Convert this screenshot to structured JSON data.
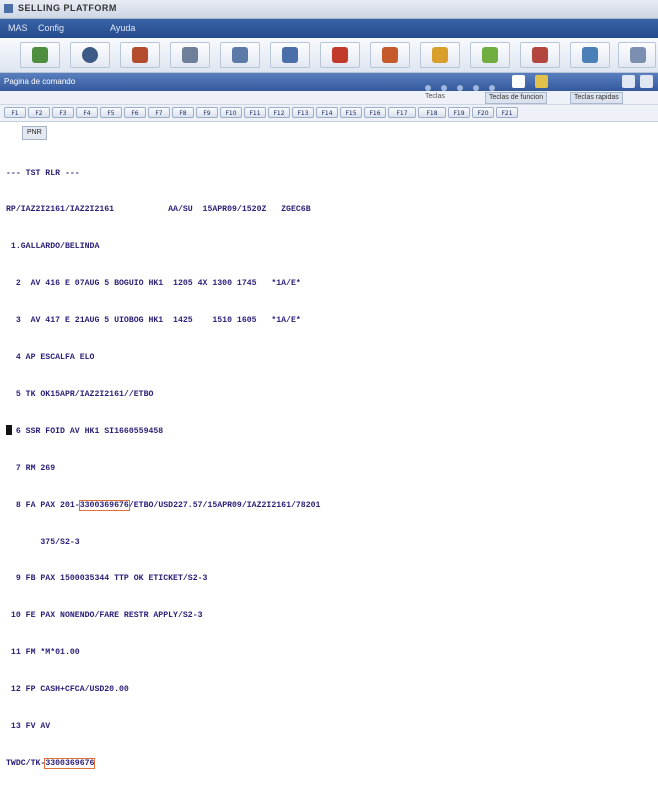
{
  "window": {
    "title": "SELLING PLATFORM"
  },
  "menu": {
    "items": [
      "MAS",
      "Config",
      "Ayuda"
    ]
  },
  "toolbar": {
    "buttons": [
      {
        "icon": "green-plus-icon",
        "color": "#4d8f3f"
      },
      {
        "icon": "globe-icon",
        "color": "#3d5a87"
      },
      {
        "icon": "phone-icon",
        "color": "#b44d2e"
      },
      {
        "icon": "calendar-icon",
        "color": "#6d7f99"
      },
      {
        "icon": "hotel-icon",
        "color": "#5c7aa8"
      },
      {
        "icon": "car-icon",
        "color": "#4a6fa8"
      },
      {
        "icon": "flag-red-icon",
        "color": "#c23a2a"
      },
      {
        "icon": "person-icon",
        "color": "#c75a2a"
      },
      {
        "icon": "question-icon",
        "color": "#d8a02a"
      },
      {
        "icon": "leaf-icon",
        "color": "#6fae3f"
      },
      {
        "icon": "book-icon",
        "color": "#b3473f"
      },
      {
        "icon": "pencil-icon",
        "color": "#4a7fb8"
      }
    ]
  },
  "statusbar": {
    "title": "Pagina de comando",
    "icons": [
      {
        "icon": "arrow-icon",
        "color": "#ffffff"
      },
      {
        "icon": "star-icon",
        "color": "#e2c14a"
      },
      {
        "icon": "search-icon",
        "color": "#e0e6f2"
      },
      {
        "icon": "print-icon",
        "color": "#e0e6f2"
      }
    ]
  },
  "subbar": {
    "label": "Teclas",
    "button1": "Teclas de funcion",
    "button2": "Teclas rapidas"
  },
  "function_keys": [
    "F1",
    "F2",
    "F3",
    "F4",
    "F5",
    "F6",
    "F7",
    "F8",
    "F9",
    "F10",
    "F11",
    "F12",
    "F13",
    "F14",
    "F15",
    "F16",
    "F17",
    "F18",
    "F19",
    "F20",
    "F21"
  ],
  "tab": {
    "label": "PNR"
  },
  "terminal": {
    "lines": [
      "--- TST RLR ---",
      "RP/IAZ2I2161/IAZ2I2161           AA/SU  15APR09/1520Z   ZGEC6B",
      " 1.GALLARDO/BELINDA",
      "  2  AV 416 E 07AUG 5 BOGUIO HK1  1205 4X 1300 1745   *1A/E*",
      "  3  AV 417 E 21AUG 5 UIOBOG HK1  1425    1510 1605   *1A/E*",
      "  4 AP ESCALFA ELO",
      "  5 TK OK15APR/IAZ2I2161//ETBO",
      "  6 SSR FOID AV HK1 SI1660559458",
      "  7 RM 269",
      "  8 FA PAX 201-3300369676/ETBO/USD227.57/15APR09/IAZ2I2161/78201",
      "       375/S2-3",
      "  9 FB PAX 1500035344 TTP OK ETICKET/S2-3",
      " 10 FE PAX NONENDO/FARE RESTR APPLY/S2-3",
      " 11 FM *M*01.00",
      " 12 FP CASH+CFCA/USD20.00",
      " 13 FV AV",
      "TWDC/TK-3300369676"
    ],
    "highlights": {
      "fa_ticket": "3300369676",
      "twd_ticket": "3300369676"
    }
  }
}
